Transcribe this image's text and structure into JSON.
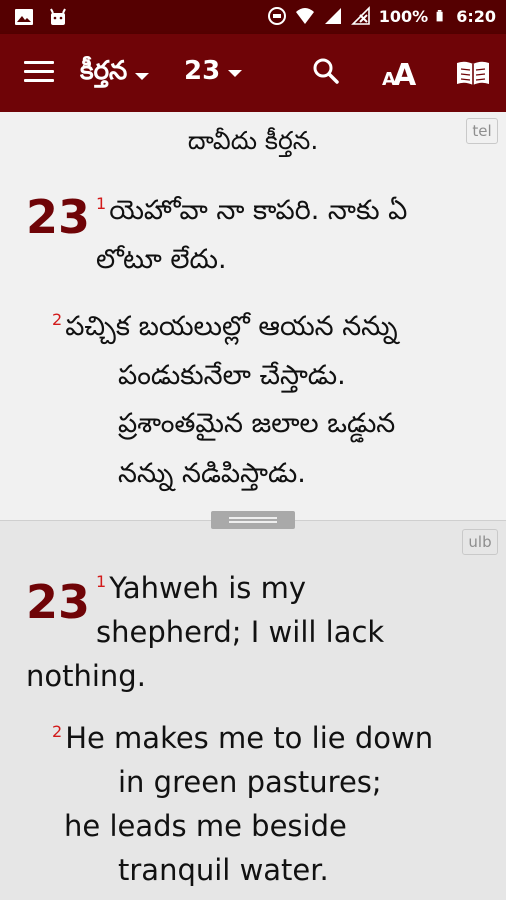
{
  "status_bar": {
    "battery": "100%",
    "time": "6:20",
    "icons": [
      "image-icon",
      "android-icon",
      "sync-icon",
      "wifi-icon",
      "signal-icon",
      "no-signal-icon",
      "battery-icon"
    ]
  },
  "app_bar": {
    "book": "కీర్తన",
    "chapter": "23",
    "icons": [
      "menu-icon",
      "search-icon",
      "font-size-icon",
      "book-icon"
    ]
  },
  "top_pane": {
    "lang": "tel",
    "title": "దావీదు కీర్తన.",
    "chapter": "23",
    "verse1": {
      "num": "1",
      "lines": [
        "యెహోవా నా కాపరి. నాకు ఏ",
        "లోటూ లేదు."
      ]
    },
    "verse2": {
      "num": "2",
      "lines": [
        "పచ్చిక బయలుల్లో ఆయన నన్ను",
        "పండుకునేలా చేస్తాడు.",
        "ప్రశాంతమైన జలాల ఒడ్డున",
        "నన్ను నడిపిస్తాడు."
      ]
    }
  },
  "bottom_pane": {
    "lang": "ulb",
    "chapter": "23",
    "verse1": {
      "num": "1",
      "lines": [
        "Yahweh is my",
        "shepherd; I will lack",
        "nothing."
      ]
    },
    "verse2": {
      "num": "2",
      "lines": [
        "He makes me to lie down",
        "in green pastures;",
        "he leads me beside",
        "tranquil water."
      ]
    }
  },
  "colors": {
    "status": "#550001",
    "appbar": "#6f0407",
    "chapter": "#6f0407",
    "verse_num": "#d21a1a"
  }
}
